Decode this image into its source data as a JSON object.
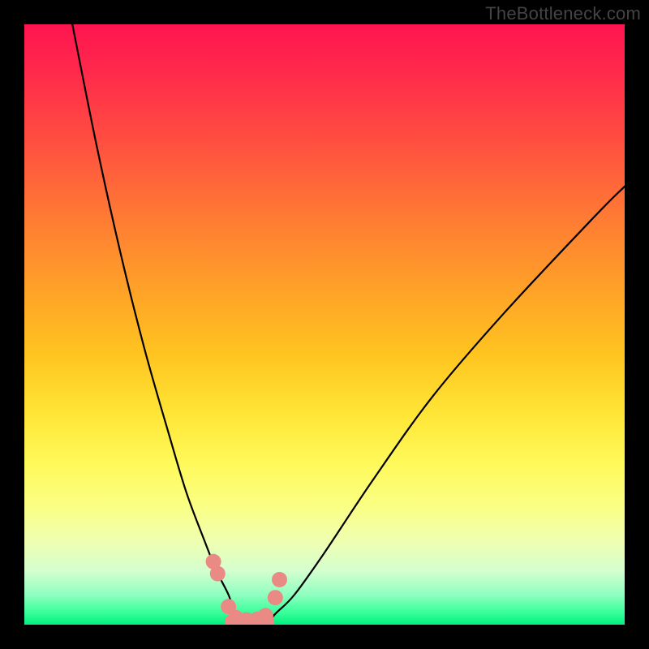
{
  "watermark": "TheBottleneck.com",
  "chart_data": {
    "type": "line",
    "title": "",
    "xlabel": "",
    "ylabel": "",
    "xlim": [
      0,
      100
    ],
    "ylim": [
      0,
      100
    ],
    "series": [
      {
        "name": "bottleneck-curve",
        "x": [
          8,
          12,
          16,
          20,
          24,
          27,
          30,
          32,
          34,
          35,
          36,
          38,
          40,
          42,
          45,
          50,
          58,
          68,
          80,
          95,
          100
        ],
        "y": [
          100,
          80,
          62,
          46,
          32,
          22,
          14,
          9,
          5,
          2,
          0,
          0,
          0,
          2,
          5,
          12,
          24,
          38,
          52,
          68,
          73
        ]
      },
      {
        "name": "marker-dots",
        "x": [
          31.5,
          32.2,
          34.0,
          35.2,
          37.0,
          38.8,
          40.2,
          41.8,
          42.5
        ],
        "y": [
          10.5,
          8.5,
          3.0,
          1.2,
          0.8,
          0.9,
          1.5,
          4.5,
          7.5
        ]
      }
    ],
    "colors": {
      "curve": "#000000",
      "markers": "#e98a85",
      "gradient_top": "#ff1450",
      "gradient_bottom": "#00f07e"
    }
  }
}
